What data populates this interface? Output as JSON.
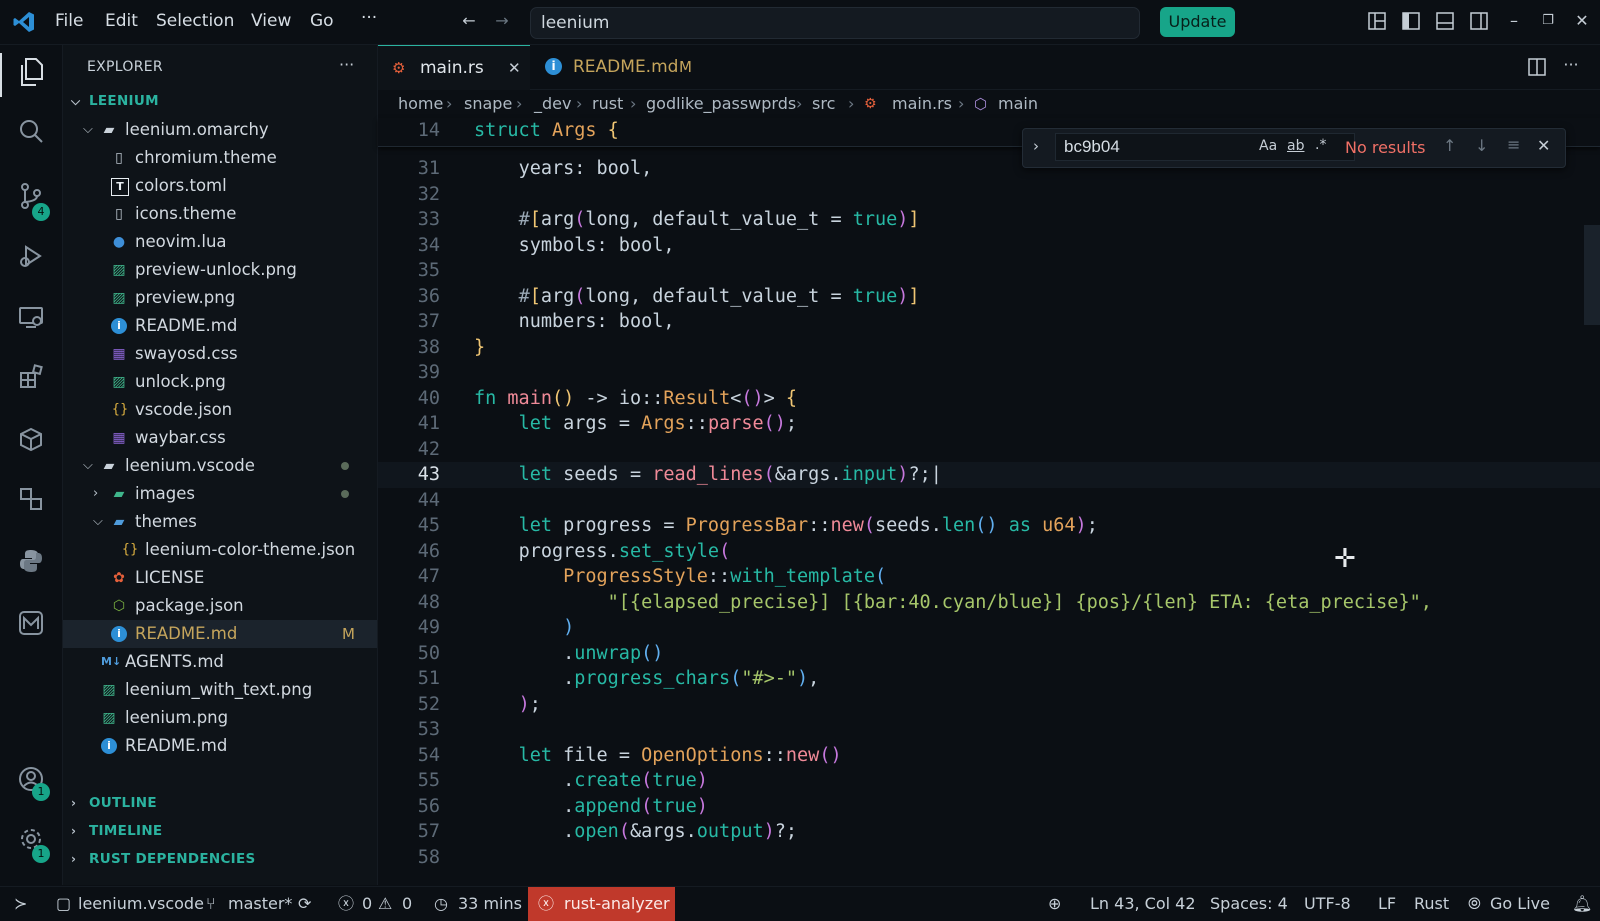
{
  "titlebar": {
    "menu": [
      "File",
      "Edit",
      "Selection",
      "View",
      "Go"
    ],
    "more": "···",
    "command_center": "leenium",
    "update_button": "Update"
  },
  "activity": {
    "scm_badge": "4",
    "accounts_badge": "1",
    "settings_badge": "1"
  },
  "sidebar": {
    "title": "EXPLORER",
    "more": "···",
    "root": "LEENIUM",
    "tree": [
      {
        "label": "leenium.omarchy",
        "depth": 1,
        "kind": "folder-open",
        "icon": "folder-icon"
      },
      {
        "label": "chromium.theme",
        "depth": 2,
        "kind": "file",
        "icon": "file-icon"
      },
      {
        "label": "colors.toml",
        "depth": 2,
        "kind": "file",
        "icon": "toml-icon"
      },
      {
        "label": "icons.theme",
        "depth": 2,
        "kind": "file",
        "icon": "file-icon"
      },
      {
        "label": "neovim.lua",
        "depth": 2,
        "kind": "file",
        "icon": "lua-icon"
      },
      {
        "label": "preview-unlock.png",
        "depth": 2,
        "kind": "file",
        "icon": "image-icon"
      },
      {
        "label": "preview.png",
        "depth": 2,
        "kind": "file",
        "icon": "image-icon"
      },
      {
        "label": "README.md",
        "depth": 2,
        "kind": "file",
        "icon": "info-icon"
      },
      {
        "label": "swayosd.css",
        "depth": 2,
        "kind": "file",
        "icon": "css-icon"
      },
      {
        "label": "unlock.png",
        "depth": 2,
        "kind": "file",
        "icon": "image-icon"
      },
      {
        "label": "vscode.json",
        "depth": 2,
        "kind": "file",
        "icon": "json-icon"
      },
      {
        "label": "waybar.css",
        "depth": 2,
        "kind": "file",
        "icon": "css-icon"
      },
      {
        "label": "leenium.vscode",
        "depth": 1,
        "kind": "folder-open",
        "icon": "folder-icon",
        "dot": true
      },
      {
        "label": "images",
        "depth": 2,
        "kind": "folder-closed",
        "icon": "folder-image-icon",
        "dot": true
      },
      {
        "label": "themes",
        "depth": 2,
        "kind": "folder-open",
        "icon": "folder-theme-icon"
      },
      {
        "label": "leenium-color-theme.json",
        "depth": 3,
        "kind": "file",
        "icon": "json-icon"
      },
      {
        "label": "LICENSE",
        "depth": 2,
        "kind": "file",
        "icon": "license-icon"
      },
      {
        "label": "package.json",
        "depth": 2,
        "kind": "file",
        "icon": "node-icon"
      },
      {
        "label": "README.md",
        "depth": 2,
        "kind": "file",
        "icon": "info-icon",
        "selected": true,
        "modified": "M"
      },
      {
        "label": "AGENTS.md",
        "depth": 1,
        "kind": "file",
        "icon": "markdown-icon"
      },
      {
        "label": "leenium_with_text.png",
        "depth": 1,
        "kind": "file",
        "icon": "image-icon"
      },
      {
        "label": "leenium.png",
        "depth": 1,
        "kind": "file",
        "icon": "image-icon"
      },
      {
        "label": "README.md",
        "depth": 1,
        "kind": "file",
        "icon": "info-icon"
      }
    ],
    "sections": [
      "OUTLINE",
      "TIMELINE",
      "RUST DEPENDENCIES"
    ]
  },
  "tabs": [
    {
      "label": "main.rs",
      "active": true
    },
    {
      "label": "README.md",
      "modified": "M"
    }
  ],
  "breadcrumb": [
    "home",
    "snape",
    "_dev",
    "rust",
    "godlike_passwprds",
    "src",
    "main.rs",
    "main"
  ],
  "sticky": {
    "ln": "14",
    "text": "struct Args {"
  },
  "find": {
    "value": "bc9b04",
    "match_case": "Aa",
    "whole_word": "ab",
    "regex": ".*",
    "result": "No results"
  },
  "code": [
    {
      "ln": "31",
      "html": "    <span class='pu'>years: bool,</span>"
    },
    {
      "ln": "32",
      "html": ""
    },
    {
      "ln": "33",
      "html": "    <span class='at'>#</span><span class='br1'>[</span><span class='pu'>arg</span><span class='br2'>(</span><span class='pu'>long, default_value_t = </span><span class='kw'>true</span><span class='br2'>)</span><span class='br1'>]</span>"
    },
    {
      "ln": "34",
      "html": "    <span class='pu'>symbols: bool,</span>"
    },
    {
      "ln": "35",
      "html": ""
    },
    {
      "ln": "36",
      "html": "    <span class='at'>#</span><span class='br1'>[</span><span class='pu'>arg</span><span class='br2'>(</span><span class='pu'>long, default_value_t = </span><span class='kw'>true</span><span class='br2'>)</span><span class='br1'>]</span>"
    },
    {
      "ln": "37",
      "html": "    <span class='pu'>numbers: bool,</span>"
    },
    {
      "ln": "38",
      "html": "<span class='br1'>}</span>"
    },
    {
      "ln": "39",
      "html": ""
    },
    {
      "ln": "40",
      "html": "<span class='kw'>fn</span> <span class='fn'>main</span><span class='br1'>()</span> <span class='pu'>-&gt; io::</span><span class='ty'>Result</span><span class='pu'>&lt;</span><span class='br2'>()</span><span class='pu'>&gt;</span> <span class='br1'>{</span>"
    },
    {
      "ln": "41",
      "html": "    <span class='kw'>let</span> <span class='pu'>args = </span><span class='ty'>Args</span><span class='pu'>::</span><span class='fn'>parse</span><span class='br2'>()</span><span class='pu'>;</span>"
    },
    {
      "ln": "42",
      "html": ""
    },
    {
      "ln": "43",
      "html": "    <span class='kw'>let</span> <span class='pu'>seeds = </span><span class='fn'>read_lines</span><span class='br2'>(</span><span class='pu'>&amp;args.</span><span class='kw'>input</span><span class='br2'>)</span><span class='pu'>?;|</span>",
      "current": true
    },
    {
      "ln": "44",
      "html": ""
    },
    {
      "ln": "45",
      "html": "    <span class='kw'>let</span> <span class='pu'>progress = </span><span class='ty'>ProgressBar</span><span class='pu'>::</span><span class='fn'>new</span><span class='br2'>(</span><span class='pu'>seeds.</span><span class='kw'>len</span><span class='br3'>()</span> <span class='kw'>as</span> <span class='ty'>u64</span><span class='br2'>)</span><span class='pu'>;</span>"
    },
    {
      "ln": "46",
      "html": "    <span class='pu'>progress.</span><span class='kw'>set_style</span><span class='br2'>(</span>"
    },
    {
      "ln": "47",
      "html": "        <span class='ty'>ProgressStyle</span><span class='pu'>::</span><span class='kw'>with_template</span><span class='br3'>(</span>"
    },
    {
      "ln": "48",
      "html": "            <span class='st'>\"[{elapsed_precise}] [{bar:40.cyan/blue}] {pos}/{len} ETA: {eta_precise}\",</span>"
    },
    {
      "ln": "49",
      "html": "        <span class='br3'>)</span>"
    },
    {
      "ln": "50",
      "html": "        <span class='pu'>.</span><span class='kw'>unwrap</span><span class='br3'>()</span>"
    },
    {
      "ln": "51",
      "html": "        <span class='pu'>.</span><span class='kw'>progress_chars</span><span class='br3'>(</span><span class='st'>\"#&gt;-\"</span><span class='br3'>)</span><span class='pu'>,</span>"
    },
    {
      "ln": "52",
      "html": "    <span class='br2'>)</span><span class='pu'>;</span>"
    },
    {
      "ln": "53",
      "html": ""
    },
    {
      "ln": "54",
      "html": "    <span class='kw'>let</span> <span class='pu'>file = </span><span class='ty'>OpenOptions</span><span class='pu'>::</span><span class='fn'>new</span><span class='br2'>()</span>"
    },
    {
      "ln": "55",
      "html": "        <span class='pu'>.</span><span class='kw'>create</span><span class='br2'>(</span><span class='kw'>true</span><span class='br2'>)</span>"
    },
    {
      "ln": "56",
      "html": "        <span class='pu'>.</span><span class='kw'>append</span><span class='br2'>(</span><span class='kw'>true</span><span class='br2'>)</span>"
    },
    {
      "ln": "57",
      "html": "        <span class='pu'>.</span><span class='kw'>open</span><span class='br2'>(</span><span class='pu'>&amp;args.</span><span class='kw'>output</span><span class='br2'>)</span><span class='pu'>?;</span>"
    },
    {
      "ln": "58",
      "html": ""
    }
  ],
  "status": {
    "workspace": "leenium.vscode",
    "branch": "master*",
    "errors": "0",
    "warnings": "0",
    "time": "33 mins",
    "rust_analyzer": "rust-analyzer",
    "position": "Ln 43, Col 42",
    "spaces": "Spaces: 4",
    "encoding": "UTF-8",
    "eol": "LF",
    "language": "Rust",
    "golive": "Go Live"
  },
  "colors": {
    "accent": "#17a589",
    "error_bg": "#c0392b",
    "folder_text": "#2bb3a0"
  }
}
